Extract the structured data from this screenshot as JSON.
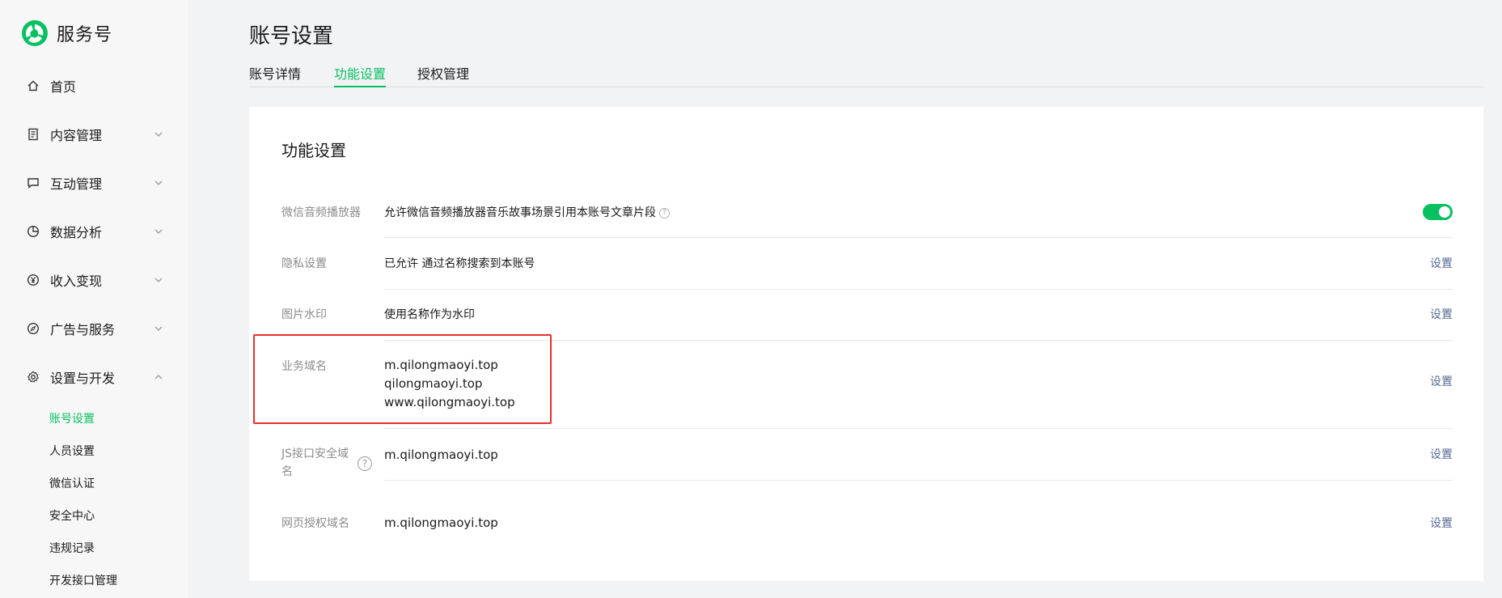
{
  "app": {
    "name": "服务号",
    "brand_color": "#07c160"
  },
  "sidebar": {
    "items": [
      {
        "label": "首页",
        "icon": "home-icon"
      },
      {
        "label": "内容管理",
        "icon": "document-icon"
      },
      {
        "label": "互动管理",
        "icon": "chat-icon"
      },
      {
        "label": "数据分析",
        "icon": "pie-chart-icon"
      },
      {
        "label": "收入变现",
        "icon": "yuan-icon"
      },
      {
        "label": "广告与服务",
        "icon": "compass-icon"
      },
      {
        "label": "设置与开发",
        "icon": "gear-icon"
      }
    ],
    "sub_items": [
      "账号设置",
      "人员设置",
      "微信认证",
      "安全中心",
      "违规记录",
      "开发接口管理"
    ]
  },
  "page": {
    "title": "账号设置",
    "tabs": [
      "账号详情",
      "功能设置",
      "授权管理"
    ],
    "active_tab": "功能设置"
  },
  "card": {
    "title": "功能设置",
    "rows": [
      {
        "label": "微信音频播放器",
        "value": "允许微信音频播放器音乐故事场景引用本账号文章片段",
        "toggle_on": true
      },
      {
        "label": "隐私设置",
        "value": "已允许 通过名称搜索到本账号",
        "action": "设置"
      },
      {
        "label": "图片水印",
        "value": "使用名称作为水印",
        "action": "设置"
      },
      {
        "label": "业务域名",
        "domains": [
          "m.qilongmaoyi.top",
          "qilongmaoyi.top",
          "www.qilongmaoyi.top"
        ],
        "action": "设置"
      },
      {
        "label_line1": "JS接口安全域",
        "label_line2": "名",
        "value": "m.qilongmaoyi.top",
        "action": "设置"
      },
      {
        "label": "网页授权域名",
        "value": "m.qilongmaoyi.top",
        "action": "设置"
      }
    ]
  },
  "help_glyph": "?",
  "highlight_color": "#e8302e"
}
